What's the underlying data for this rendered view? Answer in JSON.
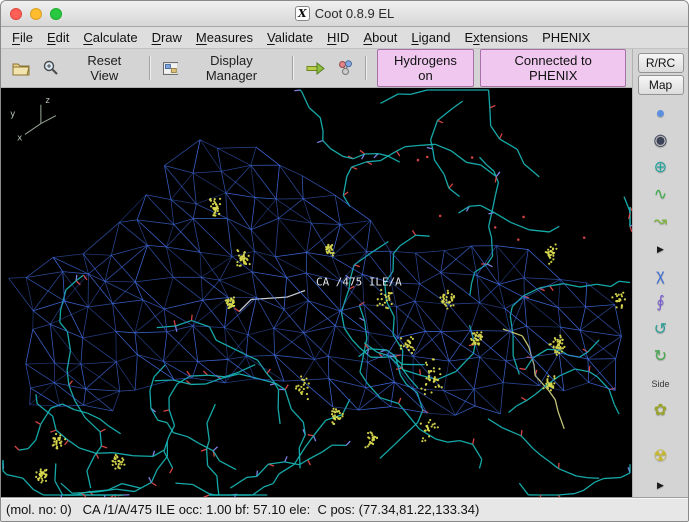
{
  "window": {
    "title": "Coot 0.8.9 EL"
  },
  "menu": {
    "items": [
      {
        "label": "File",
        "u": 0
      },
      {
        "label": "Edit",
        "u": 0
      },
      {
        "label": "Calculate",
        "u": 0
      },
      {
        "label": "Draw",
        "u": 0
      },
      {
        "label": "Measures",
        "u": 0
      },
      {
        "label": "Validate",
        "u": 0
      },
      {
        "label": "HID",
        "u": 0
      },
      {
        "label": "About",
        "u": 0
      },
      {
        "label": "Ligand",
        "u": 0
      },
      {
        "label": "Extensions",
        "u": 1
      },
      {
        "label": "PHENIX",
        "u": -1
      }
    ]
  },
  "toolbar": {
    "reset_view": "Reset View",
    "display_manager": "Display Manager",
    "hydrogens": "Hydrogens on",
    "phenix": "Connected to PHENIX"
  },
  "right_panel": {
    "rrc": "R/RC",
    "map": "Map",
    "tools": [
      {
        "name": "real-space-refine-icon",
        "glyph": "●",
        "color": "#5d8fe0"
      },
      {
        "name": "regularize-icon",
        "glyph": "◉",
        "color": "#3c4258"
      },
      {
        "name": "rigid-body-fit-icon",
        "glyph": "⊕",
        "color": "#22a49e"
      },
      {
        "name": "rotate-translate-icon",
        "glyph": "∿",
        "color": "#3db04c"
      },
      {
        "name": "auto-fit-rotamer-icon",
        "glyph": "↝",
        "color": "#7cb43e"
      },
      {
        "name": "rotamers-icon",
        "glyph": "▶",
        "color": "#1a1a1a",
        "size": 9
      },
      {
        "name": "edit-chi-angles-icon",
        "glyph": "χ",
        "color": "#3f6fd6"
      },
      {
        "name": "torsion-general-icon",
        "glyph": "∮",
        "color": "#7a5fd0"
      },
      {
        "name": "flip-peptide-icon",
        "glyph": "↺",
        "color": "#2d9f98"
      },
      {
        "name": "side-chain-180-icon",
        "glyph": "↻",
        "color": "#46a84e"
      },
      {
        "name": "side-chain-label-icon",
        "glyph": "Side",
        "color": "#333333"
      },
      {
        "name": "jed-flip-icon",
        "glyph": "✿",
        "color": "#9aa32e"
      },
      {
        "name": "spacer",
        "glyph": "",
        "color": ""
      },
      {
        "name": "mutate-autofit-icon",
        "glyph": "☢",
        "color": "#c8b728"
      },
      {
        "name": "more-tools-icon",
        "glyph": "▶",
        "color": "#1a1a1a",
        "size": 9
      }
    ]
  },
  "canvas": {
    "residue_label": "CA /475 ILE/A",
    "axes": [
      "x",
      "y",
      "z"
    ]
  },
  "statusbar": {
    "text": "(mol. no: 0)   CA /1/A/475 ILE occ: 1.00 bf: 57.10 ele:  C pos: (77.34,81.22,133.34)"
  },
  "colors": {
    "map_mesh": "#3f6adf",
    "carbon": "#17b2b2",
    "carbon_alt": "#cdd07c",
    "oxygen": "#e04848",
    "nitrogen": "#8585ee",
    "dots": "#d8d84e",
    "highlight": "#cfd6e2",
    "pink_button": "#efc7ef",
    "background": "#000000"
  }
}
